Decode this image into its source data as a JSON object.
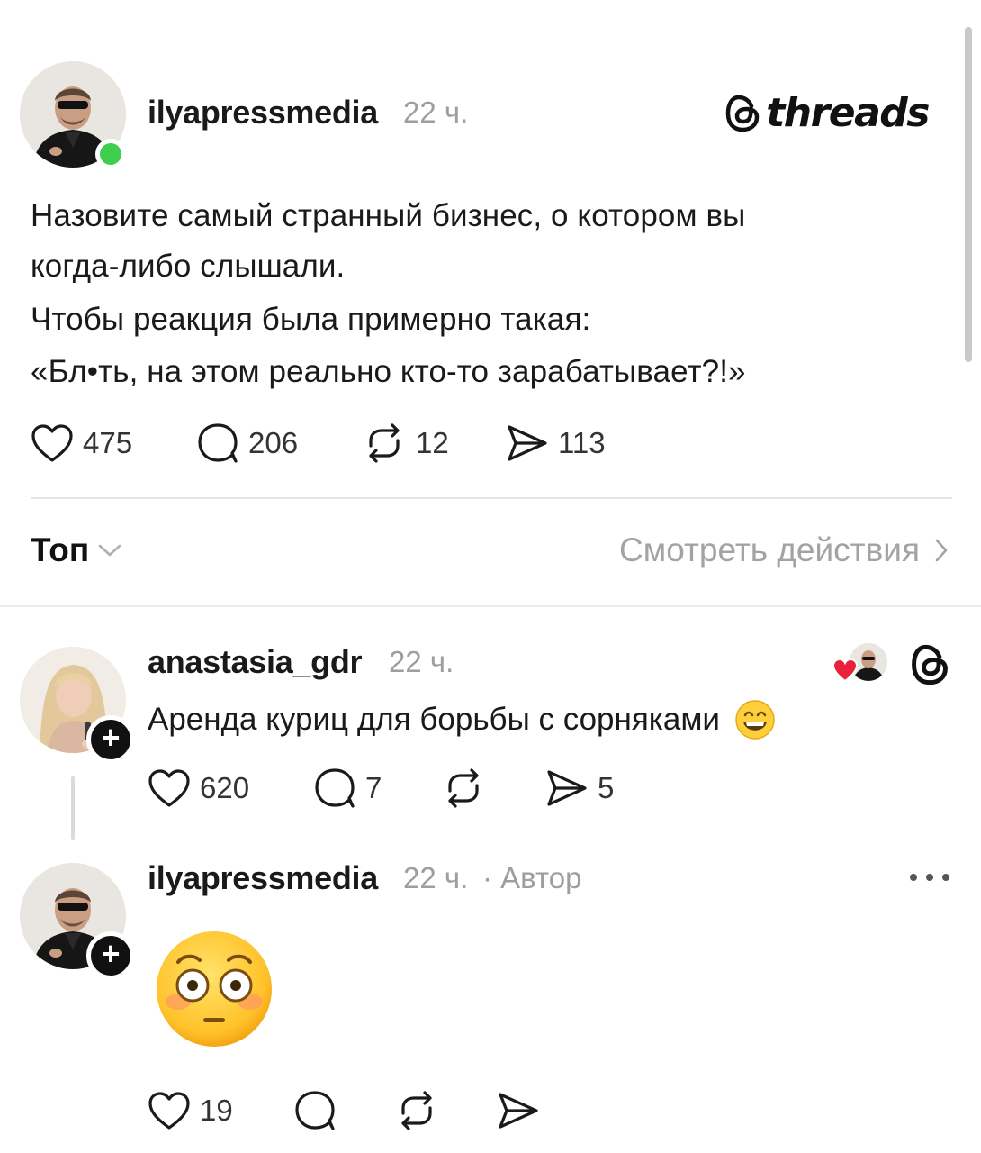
{
  "brand": {
    "name": "threads"
  },
  "post": {
    "username": "ilyapressmedia",
    "time": "22 ч.",
    "lines": [
      "Назовите самый странный бизнес, о котором вы",
      "когда-либо слышали.",
      "Чтобы реакция была примерно такая:",
      "«Бл•ть, на этом реально кто-то зарабатывает?!»"
    ],
    "likes": "475",
    "replies": "206",
    "reposts": "12",
    "shares": "113"
  },
  "sort": {
    "label": "Топ",
    "view_activity": "Смотреть действия"
  },
  "comments": [
    {
      "username": "anastasia_gdr",
      "time": "22 ч.",
      "text": "Аренда куриц для борьбы с сорняками",
      "emoji": "grinning-face",
      "likes": "620",
      "replies": "7",
      "reposts": "",
      "shares": "5"
    },
    {
      "username": "ilyapressmedia",
      "time": "22 ч.",
      "author_tag": "· Автор",
      "emoji": "flushed-face",
      "likes": "19",
      "replies": "",
      "reposts": "",
      "shares": ""
    }
  ],
  "colors": {
    "online": "#3fcf4f",
    "heart": "#e8213c",
    "muted": "#9e9e9e"
  }
}
